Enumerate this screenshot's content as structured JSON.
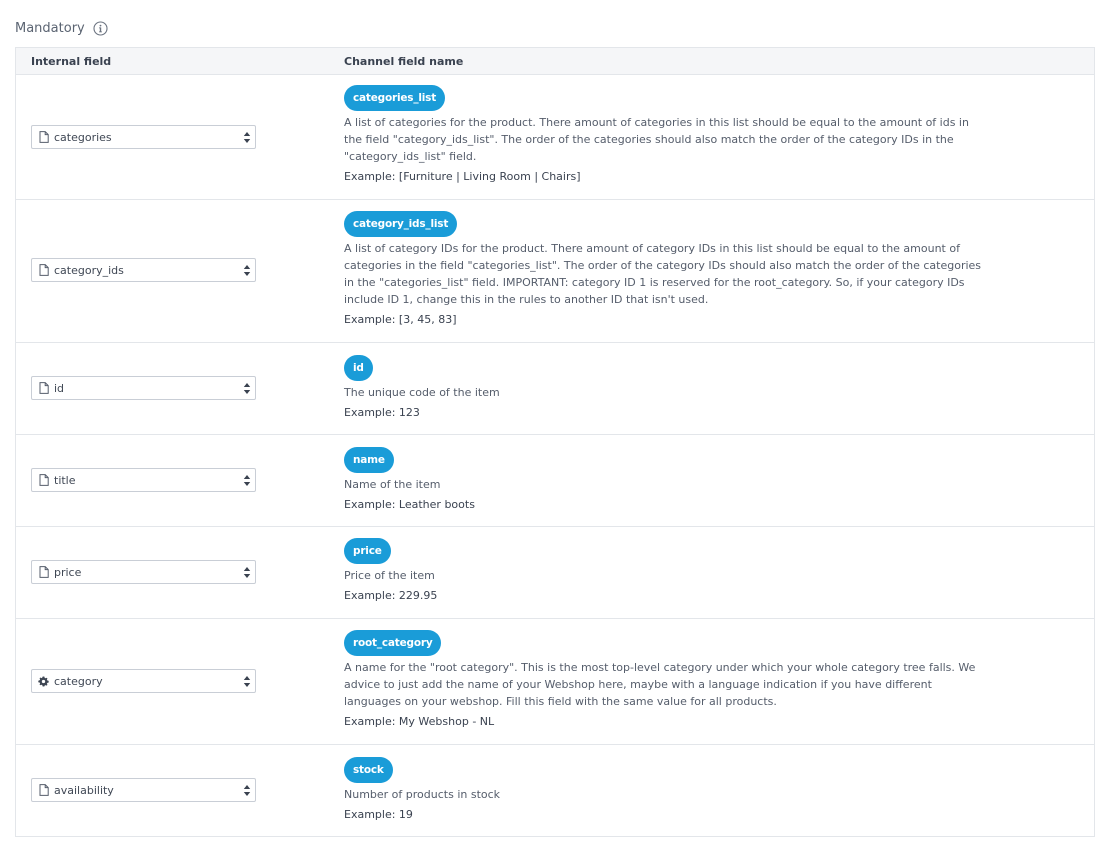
{
  "section": {
    "title": "Mandatory",
    "info_icon": "info-circle-icon"
  },
  "table": {
    "headers": {
      "internal": "Internal field",
      "channel": "Channel field name"
    },
    "rows": [
      {
        "internal": "categories",
        "internal_icon": "file-icon",
        "channel": "categories_list",
        "description": "A list of categories for the product. There amount of categories in this list should be equal to the amount of ids in the field \"category_ids_list\". The order of the categories should also match the order of the category IDs in the \"category_ids_list\" field.",
        "example": "Example: [Furniture | Living Room | Chairs]"
      },
      {
        "internal": "category_ids",
        "internal_icon": "file-icon",
        "channel": "category_ids_list",
        "description": "A list of category IDs for the product. There amount of category IDs in this list should be equal to the amount of categories in the field \"categories_list\". The order of the category IDs should also match the order of the categories in the \"categories_list\" field. IMPORTANT: category ID 1 is reserved for the root_category. So, if your category IDs include ID 1, change this in the rules to another ID that isn't used.",
        "example": "Example: [3, 45, 83]"
      },
      {
        "internal": "id",
        "internal_icon": "file-icon",
        "channel": "id",
        "description": "The unique code of the item",
        "example": "Example: 123"
      },
      {
        "internal": "title",
        "internal_icon": "file-icon",
        "channel": "name",
        "description": "Name of the item",
        "example": "Example: Leather boots"
      },
      {
        "internal": "price",
        "internal_icon": "file-icon",
        "channel": "price",
        "description": "Price of the item",
        "example": "Example: 229.95"
      },
      {
        "internal": "category",
        "internal_icon": "gear-icon",
        "channel": "root_category",
        "description": "A name for the \"root category\". This is the most top-level category under which your whole category tree falls. We advice to just add the name of your Webshop here, maybe with a language indication if you have different languages on your webshop. Fill this field with the same value for all products.",
        "example": "Example: My Webshop - NL"
      },
      {
        "internal": "availability",
        "internal_icon": "file-icon",
        "channel": "stock",
        "description": "Number of products in stock",
        "example": "Example: 19"
      }
    ]
  },
  "colors": {
    "pill": "#1a9cd8",
    "border": "#e3e6ea",
    "header_bg": "#f5f6f8"
  }
}
